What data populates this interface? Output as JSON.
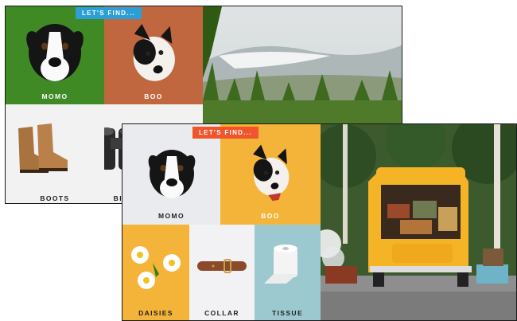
{
  "back_card": {
    "badge": "LET'S FIND...",
    "badge_color": "#2b9fd6",
    "tiles": [
      {
        "label": "MOMO",
        "bg": "#3f8a25",
        "icon": "dog-face-icon"
      },
      {
        "label": "BOO",
        "bg": "#c0673f",
        "icon": "dog-head-tilted-icon"
      },
      {
        "label": "BOOTS",
        "bg": "#f2f2f2",
        "icon": "boots-icon"
      },
      {
        "label": "BINOCULARS",
        "bg": "#f2f2f2",
        "icon": "binoculars-icon"
      }
    ],
    "scene": "mountain-landscape-image"
  },
  "front_card": {
    "badge": "LET'S FIND...",
    "badge_color": "#f0552b",
    "tiles": [
      {
        "label": "MOMO",
        "bg": "#e9ebee",
        "icon": "dog-face-icon"
      },
      {
        "label": "BOO",
        "bg": "#f4b43a",
        "icon": "dog-head-tilted-icon"
      },
      {
        "label": "DAISIES",
        "bg": "#f4b43a",
        "icon": "daisies-icon"
      },
      {
        "label": "COLLAR",
        "bg": "#f2f2f4",
        "icon": "collar-icon"
      },
      {
        "label": "TISSUE",
        "bg": "#9cc9cf",
        "icon": "tissue-roll-icon"
      }
    ],
    "scene": "yellow-van-image"
  }
}
